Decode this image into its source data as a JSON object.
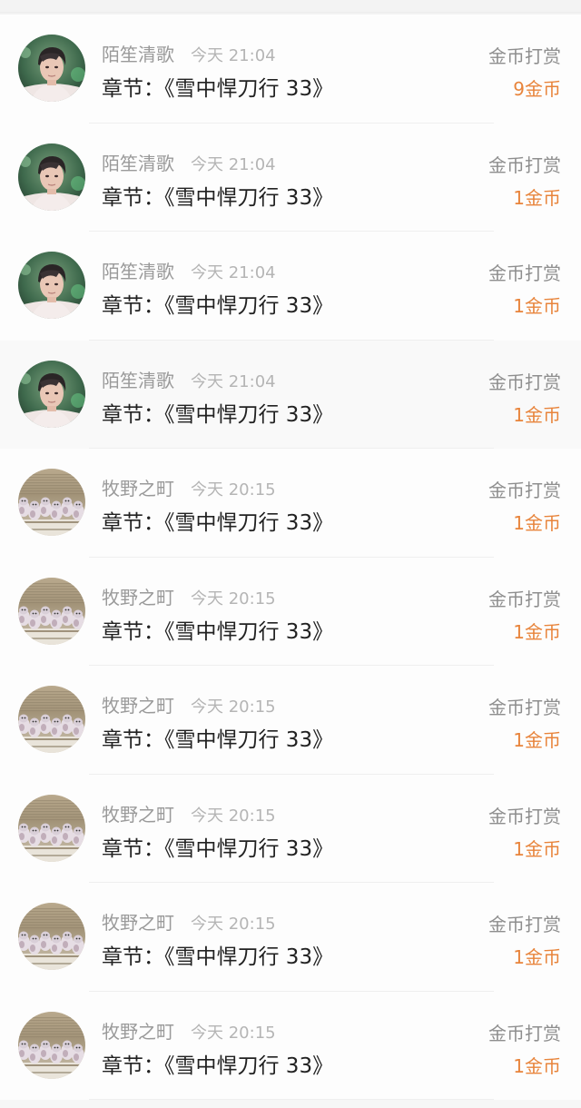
{
  "records": [
    {
      "username": "陌笙清歌",
      "time": "今天 21:04",
      "chapter": "章节：《雪中悍刀行 33》",
      "reward_type": "金币打赏",
      "amount": "9金币",
      "avatar": "avatar-portrait"
    },
    {
      "username": "陌笙清歌",
      "time": "今天 21:04",
      "chapter": "章节：《雪中悍刀行 33》",
      "reward_type": "金币打赏",
      "amount": "1金币",
      "avatar": "avatar-portrait"
    },
    {
      "username": "陌笙清歌",
      "time": "今天 21:04",
      "chapter": "章节：《雪中悍刀行 33》",
      "reward_type": "金币打赏",
      "amount": "1金币",
      "avatar": "avatar-portrait"
    },
    {
      "username": "陌笙清歌",
      "time": "今天 21:04",
      "chapter": "章节：《雪中悍刀行 33》",
      "reward_type": "金币打赏",
      "amount": "1金币",
      "avatar": "avatar-portrait"
    },
    {
      "username": "牧野之町",
      "time": "今天 20:15",
      "chapter": "章节：《雪中悍刀行 33》",
      "reward_type": "金币打赏",
      "amount": "1金币",
      "avatar": "avatar-cats"
    },
    {
      "username": "牧野之町",
      "time": "今天 20:15",
      "chapter": "章节：《雪中悍刀行 33》",
      "reward_type": "金币打赏",
      "amount": "1金币",
      "avatar": "avatar-cats"
    },
    {
      "username": "牧野之町",
      "time": "今天 20:15",
      "chapter": "章节：《雪中悍刀行 33》",
      "reward_type": "金币打赏",
      "amount": "1金币",
      "avatar": "avatar-cats"
    },
    {
      "username": "牧野之町",
      "time": "今天 20:15",
      "chapter": "章节：《雪中悍刀行 33》",
      "reward_type": "金币打赏",
      "amount": "1金币",
      "avatar": "avatar-cats"
    },
    {
      "username": "牧野之町",
      "time": "今天 20:15",
      "chapter": "章节：《雪中悍刀行 33》",
      "reward_type": "金币打赏",
      "amount": "1金币",
      "avatar": "avatar-cats"
    },
    {
      "username": "牧野之町",
      "time": "今天 20:15",
      "chapter": "章节：《雪中悍刀行 33》",
      "reward_type": "金币打赏",
      "amount": "1金币",
      "avatar": "avatar-cats"
    }
  ],
  "colors": {
    "amount": "#e8843b",
    "username": "#9a9a9a",
    "time": "#b5b5b5",
    "chapter": "#222222",
    "reward_type": "#8e8e8e"
  }
}
